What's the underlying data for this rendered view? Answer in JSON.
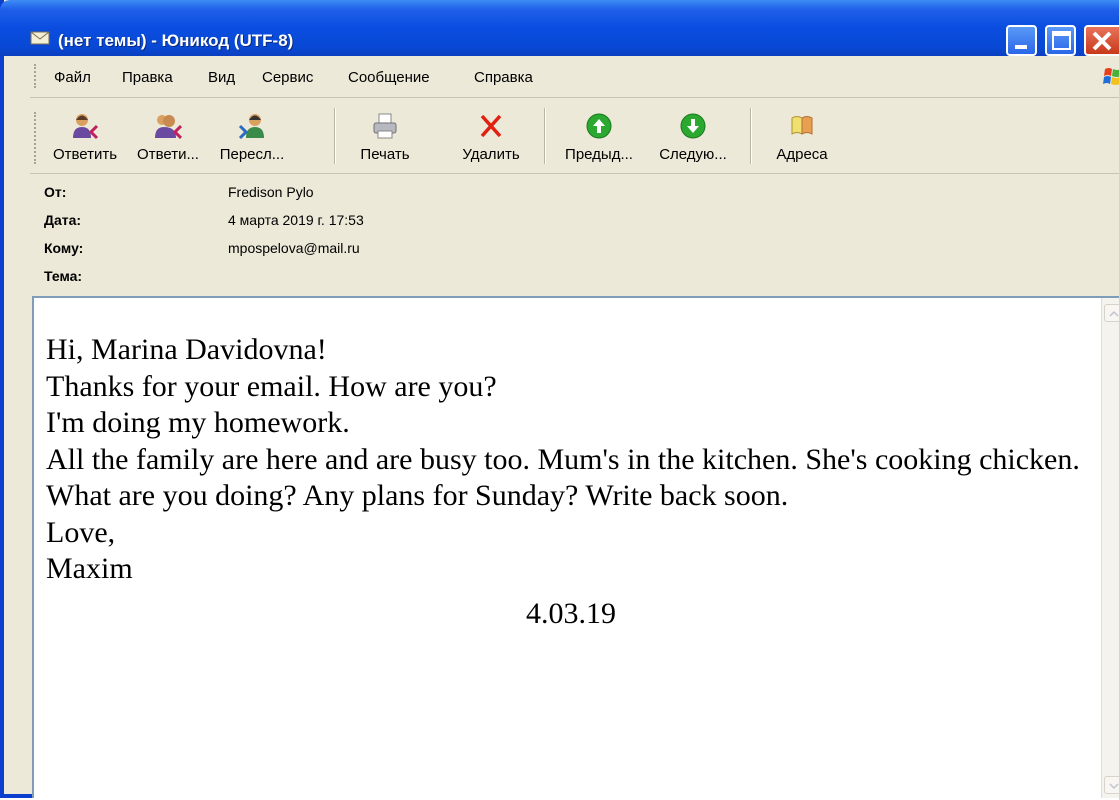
{
  "window": {
    "title": "(нет темы) - Юникод (UTF-8)"
  },
  "menu": [
    "Файл",
    "Правка",
    "Вид",
    "Сервис",
    "Сообщение",
    "Справка"
  ],
  "toolbar": {
    "reply": "Ответить",
    "reply_all": "Ответи...",
    "forward": "Пересл...",
    "print": "Печать",
    "delete": "Удалить",
    "previous": "Предыд...",
    "next": "Следую...",
    "addresses": "Адреса"
  },
  "headers": {
    "from_label": "От:",
    "from_value": "Fredison Pylo",
    "date_label": "Дата:",
    "date_value": "4 марта 2019 г. 17:53",
    "to_label": "Кому:",
    "to_value": "mpospelova@mail.ru",
    "subject_label": "Тема:",
    "subject_value": ""
  },
  "message": {
    "lines": [
      "Hi, Marina Davidovna!",
      "Thanks for your email. How are you?",
      "I'm doing my homework.",
      "All the family are here and are busy too. Mum's in the kitchen. She's cooking chicken.",
      "What are you doing? Any plans for Sunday? Write back soon.",
      "Love,",
      "Maxim"
    ],
    "date": "4.03.19"
  },
  "colors": {
    "titlebar": "#0a4de0",
    "chrome": "#ece9d8",
    "close_button": "#c8391a"
  }
}
